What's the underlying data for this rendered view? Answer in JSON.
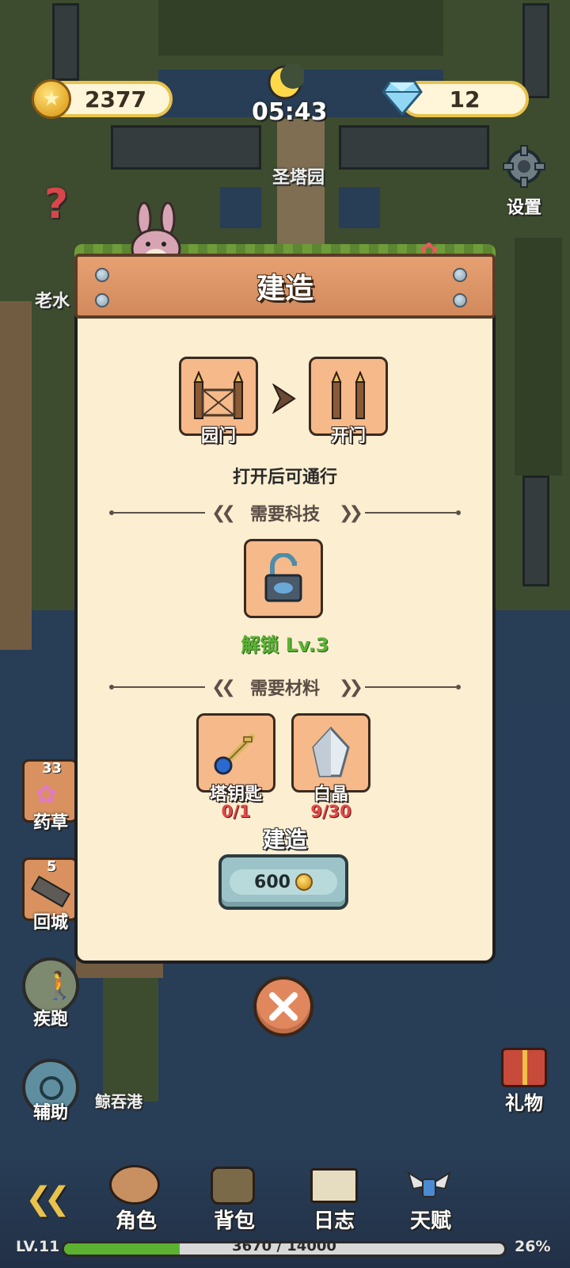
{
  "hud": {
    "coins": "2377",
    "time": "05:43",
    "gems": "12",
    "settings_label": "设置"
  },
  "map": {
    "location_label": "圣塔园",
    "npc_label": "老水",
    "port_label": "鲸吞港"
  },
  "modal": {
    "title": "建造",
    "from_item": "园门",
    "to_item": "开门",
    "description": "打开后可通行",
    "tech_section": "需要科技",
    "tech_unlock": "解锁 Lv.3",
    "material_section": "需要材料",
    "materials": [
      {
        "name": "塔钥匙",
        "count": "0/1",
        "icon": "tower-key-icon"
      },
      {
        "name": "白晶",
        "count": "9/30",
        "icon": "white-crystal-icon"
      }
    ],
    "build_label": "建造",
    "build_cost": "600"
  },
  "side_items": {
    "herb": {
      "label": "药草",
      "count": "33"
    },
    "return_city": {
      "label": "回城",
      "count": "5"
    },
    "sprint": {
      "label": "疾跑"
    },
    "assist": {
      "label": "辅助"
    },
    "gift": {
      "label": "礼物"
    }
  },
  "bottom_nav": {
    "items": [
      "角色",
      "背包",
      "日志",
      "天赋"
    ]
  },
  "player": {
    "level": "LV.11",
    "xp_text": "3670 / 14000",
    "xp_fraction": 0.262,
    "xp_percent": "26%"
  },
  "colors": {
    "accent_gold": "#e8c24a",
    "panel_bg": "#fbeed1",
    "header_wood": "#d28a5c",
    "unlock_green": "#5ab335",
    "count_red": "#e04848",
    "xp_green": "#5cb130"
  }
}
